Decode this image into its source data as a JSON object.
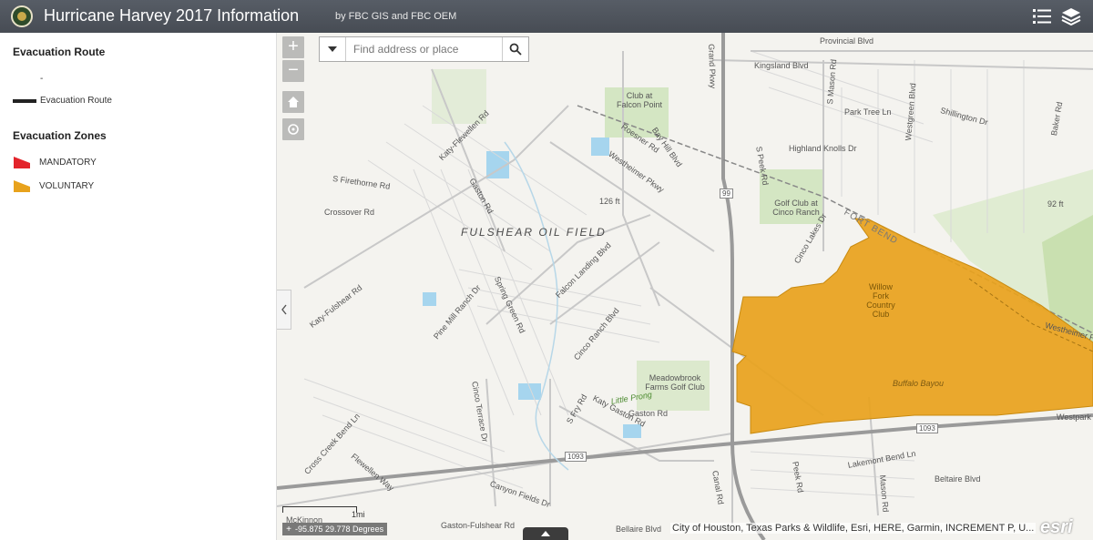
{
  "header": {
    "title": "Hurricane Harvey 2017 Information",
    "subtitle": "by FBC GIS and FBC OEM",
    "bg_color": "#4b5563"
  },
  "legend": {
    "route_heading": "Evacuation Route",
    "route_dash": "-",
    "route_item": "Evacuation Route",
    "zones_heading": "Evacuation Zones",
    "zones": [
      {
        "label": "MANDATORY",
        "color": "#e3242b"
      },
      {
        "label": "VOLUNTARY",
        "color": "#e8a21c"
      }
    ]
  },
  "search": {
    "placeholder": "Find address or place",
    "value": ""
  },
  "zoom": {
    "in": "+",
    "out": "−"
  },
  "map_labels": {
    "provincial": "Provincial Blvd",
    "kingsland": "Kingsland Blvd",
    "park_tree": "Park Tree Ln",
    "highland_knolls": "Highland Knolls Dr",
    "club_falcon": "Club at Falcon Point",
    "golf_cinco": "Golf Club at Cinco Ranch",
    "willow_fork": "Willow Fork Country Club",
    "fulshear": "FULSHEAR OIL FIELD",
    "westheimer": "Westheimer Pkwy",
    "westheimer2": "Westheimer P",
    "elev126": "126 ft",
    "elev92": "92 ft",
    "crossover": "Crossover Rd",
    "firethorne": "S Firethorne Rd",
    "katy_flewellen": "Katy-Flewellen Rd",
    "gaston": "Gaston Rd",
    "falcon_landing": "Falcon Landing Blvd",
    "spring_green": "Spring Green Rd",
    "pine_mill": "Pine Mill Ranch Dr",
    "katy_fulshear": "Katy-Fulshear Rd",
    "cinco_ranch": "Cinco Ranch Blvd",
    "meadowbrook": "Meadowbrook Farms Golf Club",
    "little_prong": "Little Prong",
    "cinco_terrace": "Cinco Terrace Dr",
    "fry": "S Fry Rd",
    "katy_gaston": "Katy Gaston Rd",
    "gaston2": "Gaston Rd",
    "cross_creek": "Cross Creek Bend Ln",
    "flewellen_way": "Flewellen Way",
    "canyon_fields": "Canyon Fields Dr",
    "gaston_fulshear": "Gaston-Fulshear Rd",
    "mckinnon": "McKinnon",
    "bellaire": "Bellaire Blvd",
    "bellaire2": "Beltaire Blvd",
    "canal": "Canal Rd",
    "peek": "Peek Rd",
    "mason": "Mason Rd",
    "lakemont": "Lakemont Bend Ln",
    "westpark": "Westpark",
    "grand_pkwy": "Grand Pkwy",
    "roesner": "Roesner Rd",
    "bay_hill": "Bay Hill Blvd",
    "s_peek": "S Peek Rd",
    "s_mason": "S Mason Rd",
    "westgreen": "Westgreen Blvd",
    "shillington": "Shillington Dr",
    "baker": "Baker Rd",
    "cinco_lakes": "Cinco Lakes Dr",
    "hwy99": "99",
    "hwy1093a": "1093",
    "hwy1093b": "1093",
    "buffalo_bayou": "Buffalo Bayou",
    "hwy_label": "FORT BEND"
  },
  "scale": {
    "label": "1mi"
  },
  "coords": {
    "text": "-95.875 29.778 Degrees"
  },
  "attribution": "City of Houston, Texas Parks & Wildlife, Esri, HERE, Garmin, INCREMENT P, U...",
  "esri_logo": "esri",
  "colors": {
    "voluntary": "#e8a21c",
    "mandatory": "#e3242b",
    "road_major": "#999999",
    "water": "#a6d5ee",
    "park": "#d4e6c3"
  }
}
